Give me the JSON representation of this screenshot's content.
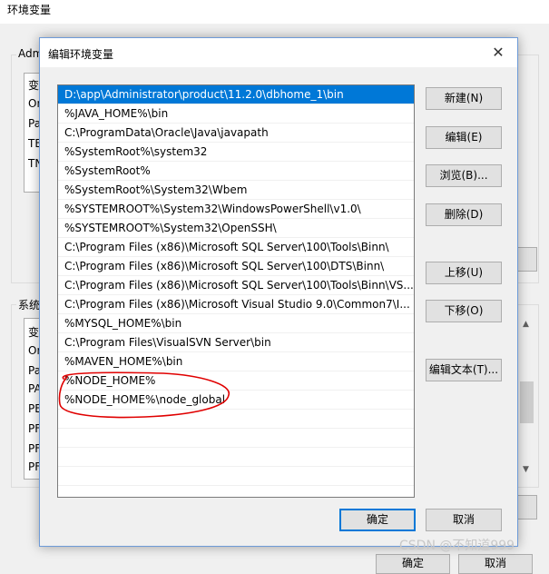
{
  "background_window": {
    "title": "环境变量",
    "user_group_label": "Adm",
    "user_rows": [
      "变",
      "Or",
      "Pa",
      "TE",
      "TN"
    ],
    "system_group_label": "系统",
    "system_rows": [
      "变",
      "Or",
      "Pa",
      "PA",
      "PE",
      "PF",
      "PF",
      "PF"
    ],
    "ok_label": "确定",
    "cancel_label": "取消"
  },
  "dialog": {
    "title": "编辑环境变量",
    "close_glyph": "✕",
    "paths": [
      "D:\\app\\Administrator\\product\\11.2.0\\dbhome_1\\bin",
      "%JAVA_HOME%\\bin",
      "C:\\ProgramData\\Oracle\\Java\\javapath",
      "%SystemRoot%\\system32",
      "%SystemRoot%",
      "%SystemRoot%\\System32\\Wbem",
      "%SYSTEMROOT%\\System32\\WindowsPowerShell\\v1.0\\",
      "%SYSTEMROOT%\\System32\\OpenSSH\\",
      "C:\\Program Files (x86)\\Microsoft SQL Server\\100\\Tools\\Binn\\",
      "C:\\Program Files (x86)\\Microsoft SQL Server\\100\\DTS\\Binn\\",
      "C:\\Program Files (x86)\\Microsoft SQL Server\\100\\Tools\\Binn\\VS...",
      "C:\\Program Files (x86)\\Microsoft Visual Studio 9.0\\Common7\\I...",
      "%MYSQL_HOME%\\bin",
      "C:\\Program Files\\VisualSVN Server\\bin",
      "%MAVEN_HOME%\\bin",
      "%NODE_HOME%",
      "%NODE_HOME%\\node_global"
    ],
    "selected_index": 0,
    "buttons": {
      "new": "新建(N)",
      "edit": "编辑(E)",
      "browse": "浏览(B)...",
      "delete": "删除(D)",
      "move_up": "上移(U)",
      "move_down": "下移(O)",
      "edit_text": "编辑文本(T)...",
      "ok": "确定",
      "cancel": "取消"
    }
  },
  "watermark": "CSDN @不知道999",
  "colors": {
    "selection": "#0078d7",
    "annotation": "#e00000"
  }
}
